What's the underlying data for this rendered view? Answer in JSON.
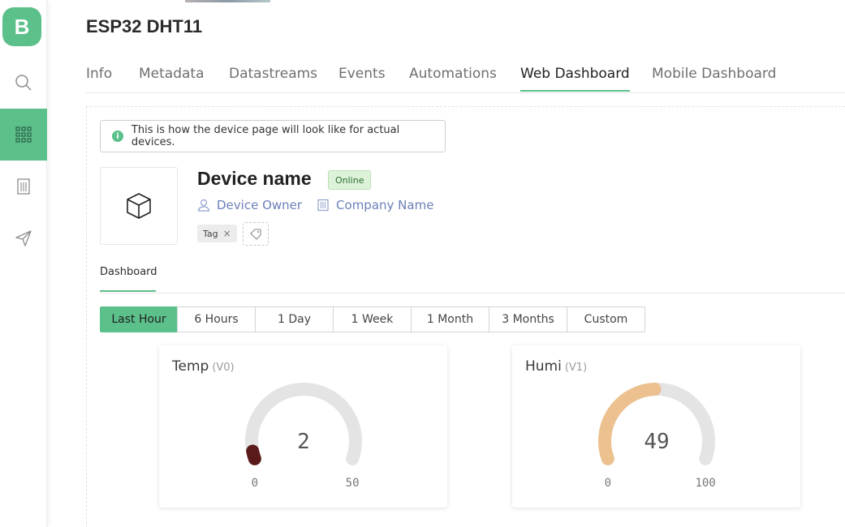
{
  "sidebar": {
    "logo": "B",
    "items": [
      {
        "name": "search",
        "icon": "search-icon"
      },
      {
        "name": "devices",
        "icon": "grid-icon",
        "active": true
      },
      {
        "name": "organizations",
        "icon": "building-icon"
      },
      {
        "name": "send",
        "icon": "paper-plane-icon"
      }
    ]
  },
  "page": {
    "title": "ESP32 DHT11"
  },
  "tabs": [
    {
      "label": "Info"
    },
    {
      "label": "Metadata"
    },
    {
      "label": "Datastreams"
    },
    {
      "label": "Events"
    },
    {
      "label": "Automations"
    },
    {
      "label": "Web Dashboard",
      "active": true
    },
    {
      "label": "Mobile Dashboard"
    }
  ],
  "notice": {
    "icon": "info-icon",
    "text": "This is how the device page will look like for actual devices."
  },
  "device": {
    "name": "Device name",
    "status": "Online",
    "owner": "Device Owner",
    "company": "Company Name",
    "tag": "Tag"
  },
  "sub_tabs": [
    {
      "label": "Dashboard",
      "active": true
    }
  ],
  "time_ranges": [
    {
      "label": "Last Hour",
      "active": true
    },
    {
      "label": "6 Hours"
    },
    {
      "label": "1 Day"
    },
    {
      "label": "1 Week"
    },
    {
      "label": "1 Month"
    },
    {
      "label": "3 Months"
    },
    {
      "label": "Custom"
    }
  ],
  "widgets": [
    {
      "title": "Temp",
      "pin": "(V0)",
      "value": 2,
      "value_label": "2",
      "min": 0,
      "max": 50,
      "min_label": "0",
      "max_label": "50",
      "color": "#5a1a1a"
    },
    {
      "title": "Humi",
      "pin": "(V1)",
      "value": 49,
      "value_label": "49",
      "min": 0,
      "max": 100,
      "min_label": "0",
      "max_label": "100",
      "color": "#ecc08f"
    }
  ],
  "colors": {
    "accent": "#5cc08b",
    "link": "#6c7fb8",
    "track": "#e4e4e4"
  }
}
